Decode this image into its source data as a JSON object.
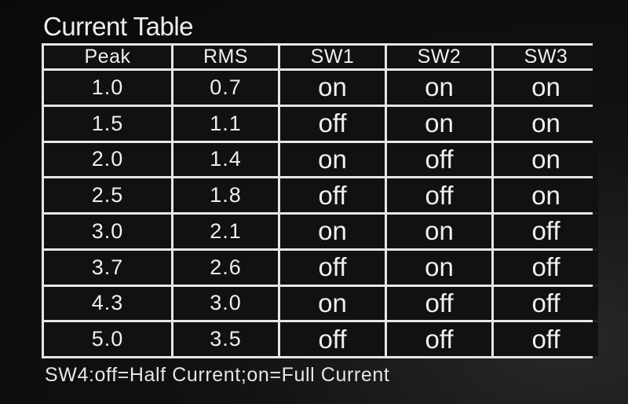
{
  "title": "Current Table",
  "table": {
    "headers": [
      "Peak",
      "RMS",
      "SW1",
      "SW2",
      "SW3"
    ],
    "rows": [
      {
        "peak": "1.0",
        "rms": "0.7",
        "sw1": "on",
        "sw2": "on",
        "sw3": "on"
      },
      {
        "peak": "1.5",
        "rms": "1.1",
        "sw1": "off",
        "sw2": "on",
        "sw3": "on"
      },
      {
        "peak": "2.0",
        "rms": "1.4",
        "sw1": "on",
        "sw2": "off",
        "sw3": "on"
      },
      {
        "peak": "2.5",
        "rms": "1.8",
        "sw1": "off",
        "sw2": "off",
        "sw3": "on"
      },
      {
        "peak": "3.0",
        "rms": "2.1",
        "sw1": "on",
        "sw2": "on",
        "sw3": "off"
      },
      {
        "peak": "3.7",
        "rms": "2.6",
        "sw1": "off",
        "sw2": "on",
        "sw3": "off"
      },
      {
        "peak": "4.3",
        "rms": "3.0",
        "sw1": "on",
        "sw2": "off",
        "sw3": "off"
      },
      {
        "peak": "5.0",
        "rms": "3.5",
        "sw1": "off",
        "sw2": "off",
        "sw3": "off"
      }
    ]
  },
  "footer": "SW4:off=Half Current;on=Full Current",
  "colors": {
    "background": "#0e0c0b",
    "text": "#ececec",
    "grid": "#e6e6e6"
  }
}
